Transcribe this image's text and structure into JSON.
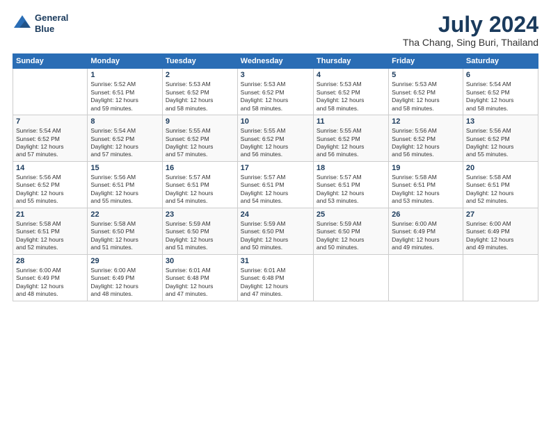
{
  "header": {
    "logo_line1": "General",
    "logo_line2": "Blue",
    "title": "July 2024",
    "location": "Tha Chang, Sing Buri, Thailand"
  },
  "columns": [
    "Sunday",
    "Monday",
    "Tuesday",
    "Wednesday",
    "Thursday",
    "Friday",
    "Saturday"
  ],
  "weeks": [
    [
      {
        "day": "",
        "text": ""
      },
      {
        "day": "1",
        "text": "Sunrise: 5:52 AM\nSunset: 6:51 PM\nDaylight: 12 hours\nand 59 minutes."
      },
      {
        "day": "2",
        "text": "Sunrise: 5:53 AM\nSunset: 6:52 PM\nDaylight: 12 hours\nand 58 minutes."
      },
      {
        "day": "3",
        "text": "Sunrise: 5:53 AM\nSunset: 6:52 PM\nDaylight: 12 hours\nand 58 minutes."
      },
      {
        "day": "4",
        "text": "Sunrise: 5:53 AM\nSunset: 6:52 PM\nDaylight: 12 hours\nand 58 minutes."
      },
      {
        "day": "5",
        "text": "Sunrise: 5:53 AM\nSunset: 6:52 PM\nDaylight: 12 hours\nand 58 minutes."
      },
      {
        "day": "6",
        "text": "Sunrise: 5:54 AM\nSunset: 6:52 PM\nDaylight: 12 hours\nand 58 minutes."
      }
    ],
    [
      {
        "day": "7",
        "text": "Sunrise: 5:54 AM\nSunset: 6:52 PM\nDaylight: 12 hours\nand 57 minutes."
      },
      {
        "day": "8",
        "text": "Sunrise: 5:54 AM\nSunset: 6:52 PM\nDaylight: 12 hours\nand 57 minutes."
      },
      {
        "day": "9",
        "text": "Sunrise: 5:55 AM\nSunset: 6:52 PM\nDaylight: 12 hours\nand 57 minutes."
      },
      {
        "day": "10",
        "text": "Sunrise: 5:55 AM\nSunset: 6:52 PM\nDaylight: 12 hours\nand 56 minutes."
      },
      {
        "day": "11",
        "text": "Sunrise: 5:55 AM\nSunset: 6:52 PM\nDaylight: 12 hours\nand 56 minutes."
      },
      {
        "day": "12",
        "text": "Sunrise: 5:56 AM\nSunset: 6:52 PM\nDaylight: 12 hours\nand 56 minutes."
      },
      {
        "day": "13",
        "text": "Sunrise: 5:56 AM\nSunset: 6:52 PM\nDaylight: 12 hours\nand 55 minutes."
      }
    ],
    [
      {
        "day": "14",
        "text": "Sunrise: 5:56 AM\nSunset: 6:52 PM\nDaylight: 12 hours\nand 55 minutes."
      },
      {
        "day": "15",
        "text": "Sunrise: 5:56 AM\nSunset: 6:51 PM\nDaylight: 12 hours\nand 55 minutes."
      },
      {
        "day": "16",
        "text": "Sunrise: 5:57 AM\nSunset: 6:51 PM\nDaylight: 12 hours\nand 54 minutes."
      },
      {
        "day": "17",
        "text": "Sunrise: 5:57 AM\nSunset: 6:51 PM\nDaylight: 12 hours\nand 54 minutes."
      },
      {
        "day": "18",
        "text": "Sunrise: 5:57 AM\nSunset: 6:51 PM\nDaylight: 12 hours\nand 53 minutes."
      },
      {
        "day": "19",
        "text": "Sunrise: 5:58 AM\nSunset: 6:51 PM\nDaylight: 12 hours\nand 53 minutes."
      },
      {
        "day": "20",
        "text": "Sunrise: 5:58 AM\nSunset: 6:51 PM\nDaylight: 12 hours\nand 52 minutes."
      }
    ],
    [
      {
        "day": "21",
        "text": "Sunrise: 5:58 AM\nSunset: 6:51 PM\nDaylight: 12 hours\nand 52 minutes."
      },
      {
        "day": "22",
        "text": "Sunrise: 5:58 AM\nSunset: 6:50 PM\nDaylight: 12 hours\nand 51 minutes."
      },
      {
        "day": "23",
        "text": "Sunrise: 5:59 AM\nSunset: 6:50 PM\nDaylight: 12 hours\nand 51 minutes."
      },
      {
        "day": "24",
        "text": "Sunrise: 5:59 AM\nSunset: 6:50 PM\nDaylight: 12 hours\nand 50 minutes."
      },
      {
        "day": "25",
        "text": "Sunrise: 5:59 AM\nSunset: 6:50 PM\nDaylight: 12 hours\nand 50 minutes."
      },
      {
        "day": "26",
        "text": "Sunrise: 6:00 AM\nSunset: 6:49 PM\nDaylight: 12 hours\nand 49 minutes."
      },
      {
        "day": "27",
        "text": "Sunrise: 6:00 AM\nSunset: 6:49 PM\nDaylight: 12 hours\nand 49 minutes."
      }
    ],
    [
      {
        "day": "28",
        "text": "Sunrise: 6:00 AM\nSunset: 6:49 PM\nDaylight: 12 hours\nand 48 minutes."
      },
      {
        "day": "29",
        "text": "Sunrise: 6:00 AM\nSunset: 6:49 PM\nDaylight: 12 hours\nand 48 minutes."
      },
      {
        "day": "30",
        "text": "Sunrise: 6:01 AM\nSunset: 6:48 PM\nDaylight: 12 hours\nand 47 minutes."
      },
      {
        "day": "31",
        "text": "Sunrise: 6:01 AM\nSunset: 6:48 PM\nDaylight: 12 hours\nand 47 minutes."
      },
      {
        "day": "",
        "text": ""
      },
      {
        "day": "",
        "text": ""
      },
      {
        "day": "",
        "text": ""
      }
    ]
  ]
}
